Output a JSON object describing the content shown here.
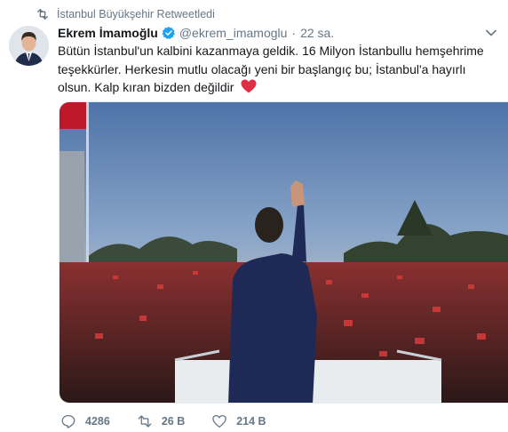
{
  "retweet_bar": {
    "text": "İstanbul Büyükşehir Retweetledi",
    "icon": "retweet-icon"
  },
  "tweet": {
    "author_name": "Ekrem İmamoğlu",
    "handle": "@ekrem_imamoglu",
    "separator": "·",
    "time": "22 sa.",
    "verified": true,
    "text_main": "Bütün İstanbul'un kalbini kazanmaya geldik. 16 Milyon İstanbullu hemşehrime teşekkürler. Herkesin mutlu olacağı yeni bir başlangıç bu; İstanbul'a hayırlı olsun. Kalp kıran bizden değildir",
    "emoji": "red-heart-icon"
  },
  "actions": {
    "reply_count": "4286",
    "retweet_count": "26 B",
    "like_count": "214 B"
  },
  "colors": {
    "text_primary": "#14171a",
    "text_secondary": "#657786",
    "verified_blue": "#1da1f2",
    "heart_red": "#e0245e",
    "border": "#e6ecf0"
  }
}
